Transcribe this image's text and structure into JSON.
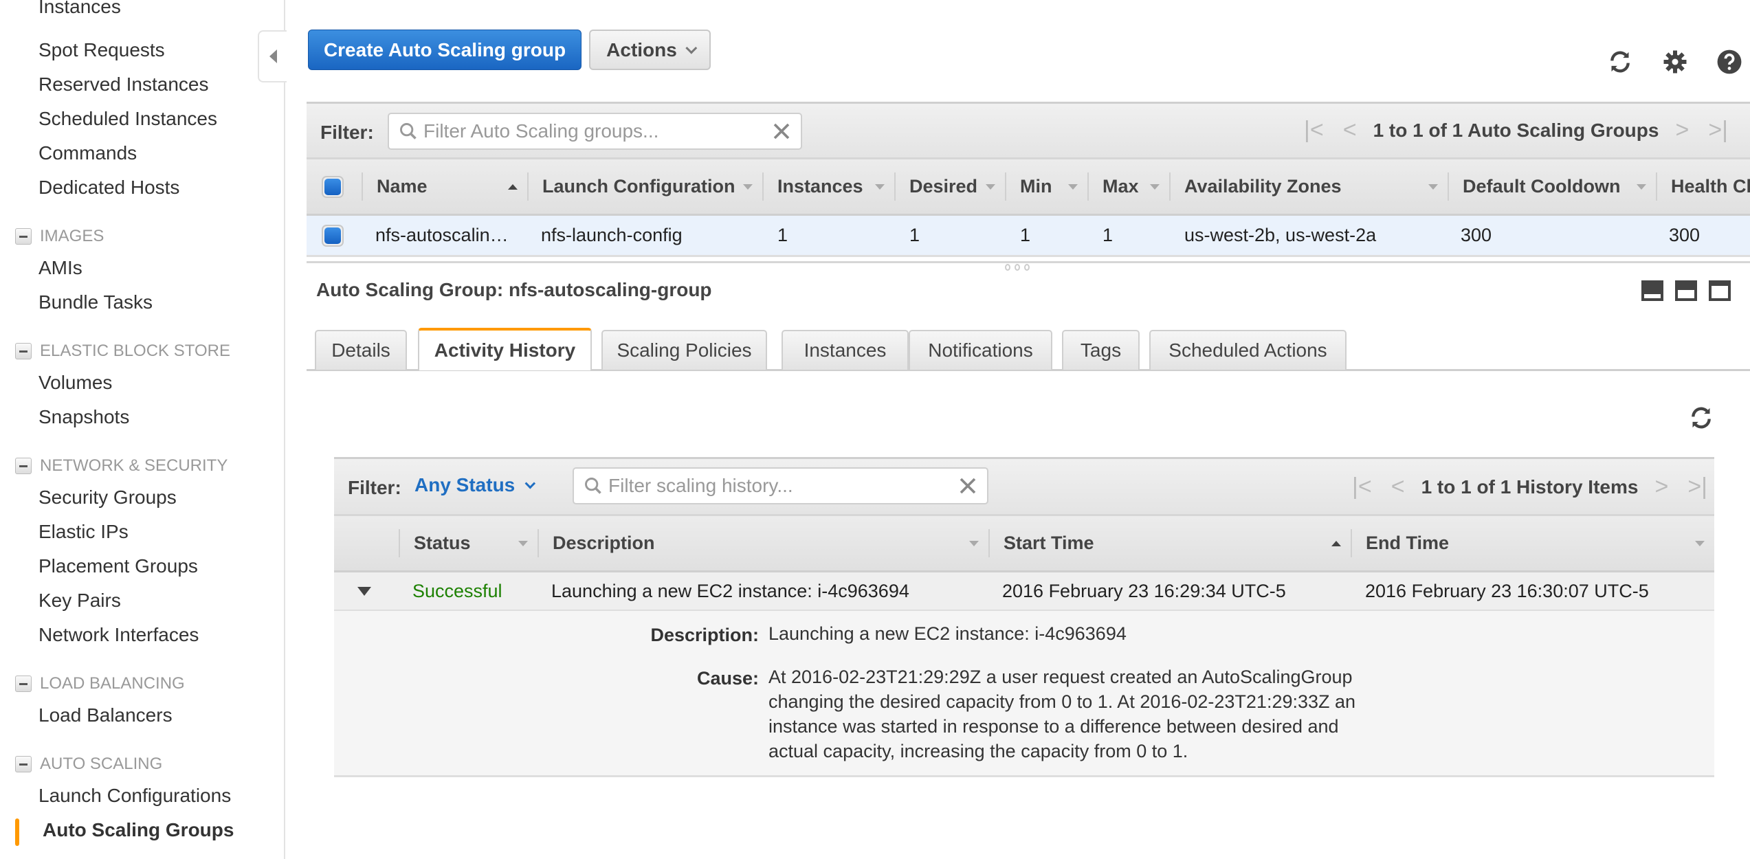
{
  "sidebar": {
    "items_top": [
      "Instances",
      "Spot Requests",
      "Reserved Instances",
      "Scheduled Instances",
      "Commands",
      "Dedicated Hosts"
    ],
    "sections": [
      {
        "title": "IMAGES",
        "items": [
          "AMIs",
          "Bundle Tasks"
        ]
      },
      {
        "title": "ELASTIC BLOCK STORE",
        "items": [
          "Volumes",
          "Snapshots"
        ]
      },
      {
        "title": "NETWORK & SECURITY",
        "items": [
          "Security Groups",
          "Elastic IPs",
          "Placement Groups",
          "Key Pairs",
          "Network Interfaces"
        ]
      },
      {
        "title": "LOAD BALANCING",
        "items": [
          "Load Balancers"
        ]
      },
      {
        "title": "AUTO SCALING",
        "items": [
          "Launch Configurations",
          "Auto Scaling Groups"
        ]
      }
    ],
    "active_item": "Auto Scaling Groups",
    "accent_color": "#ff9900"
  },
  "toolbar": {
    "create_label": "Create Auto Scaling group",
    "actions_label": "Actions",
    "icons": [
      "refresh-icon",
      "gear-icon",
      "help-icon"
    ]
  },
  "groups_table": {
    "filter_label": "Filter:",
    "filter_placeholder": "Filter Auto Scaling groups...",
    "pager_text": "1 to 1 of 1 Auto Scaling Groups",
    "columns": [
      "Name",
      "Launch Configuration",
      "Instances",
      "Desired",
      "Min",
      "Max",
      "Availability Zones",
      "Default Cooldown",
      "Health Cl"
    ],
    "sorted_column": "Name",
    "rows": [
      {
        "name": "nfs-autoscalin…",
        "launch_config": "nfs-launch-config",
        "instances": "1",
        "desired": "1",
        "min": "1",
        "max": "1",
        "zones": "us-west-2b, us-west-2a",
        "cooldown": "300",
        "health": "300",
        "selected": true
      }
    ]
  },
  "details": {
    "title": "Auto Scaling Group: nfs-autoscaling-group",
    "tabs": [
      "Details",
      "Activity History",
      "Scaling Policies",
      "Instances",
      "Notifications",
      "Tags",
      "Scheduled Actions"
    ],
    "active_tab": "Activity History"
  },
  "history": {
    "filter_label": "Filter:",
    "status_filter": "Any Status",
    "search_placeholder": "Filter scaling history...",
    "pager_text": "1 to 1 of 1 History Items",
    "columns": [
      "Status",
      "Description",
      "Start Time",
      "End Time"
    ],
    "sorted_column": "Start Time",
    "rows": [
      {
        "status": "Successful",
        "status_color": "#1d8102",
        "description": "Launching a new EC2 instance: i-4c963694",
        "start_time": "2016 February 23 16:29:34 UTC-5",
        "end_time": "2016 February 23 16:30:07 UTC-5",
        "expanded": true
      }
    ],
    "expanded_detail": {
      "description_label": "Description:",
      "description": "Launching a new EC2 instance: i-4c963694",
      "cause_label": "Cause:",
      "cause": "At 2016-02-23T21:29:29Z a user request created an AutoScalingGroup changing the desired capacity from 0 to 1. At 2016-02-23T21:29:33Z an instance was started in response to a difference between desired and actual capacity, increasing the capacity from 0 to 1."
    }
  }
}
